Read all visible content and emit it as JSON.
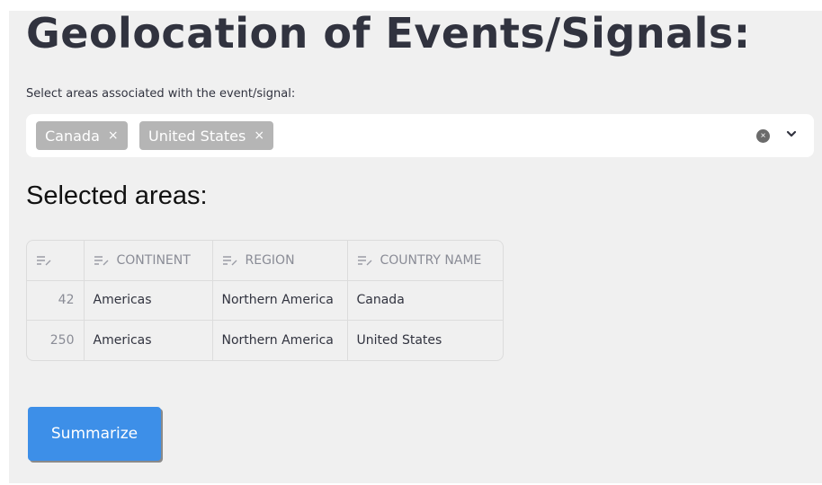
{
  "header": {
    "title": "Geolocation of Events/Signals:"
  },
  "area_select": {
    "label": "Select areas associated with the event/signal:",
    "selected": [
      {
        "label": "Canada",
        "remove": "×"
      },
      {
        "label": "United States",
        "remove": "×"
      }
    ],
    "clear_glyph": "×"
  },
  "selected_areas": {
    "heading": "Selected areas:",
    "columns": [
      "",
      "CONTINENT",
      "REGION",
      "COUNTRY NAME"
    ],
    "rows": [
      [
        "42",
        "Americas",
        "Northern America",
        "Canada"
      ],
      [
        "250",
        "Americas",
        "Northern America",
        "United States"
      ]
    ]
  },
  "actions": {
    "summarize_label": "Summarize"
  }
}
